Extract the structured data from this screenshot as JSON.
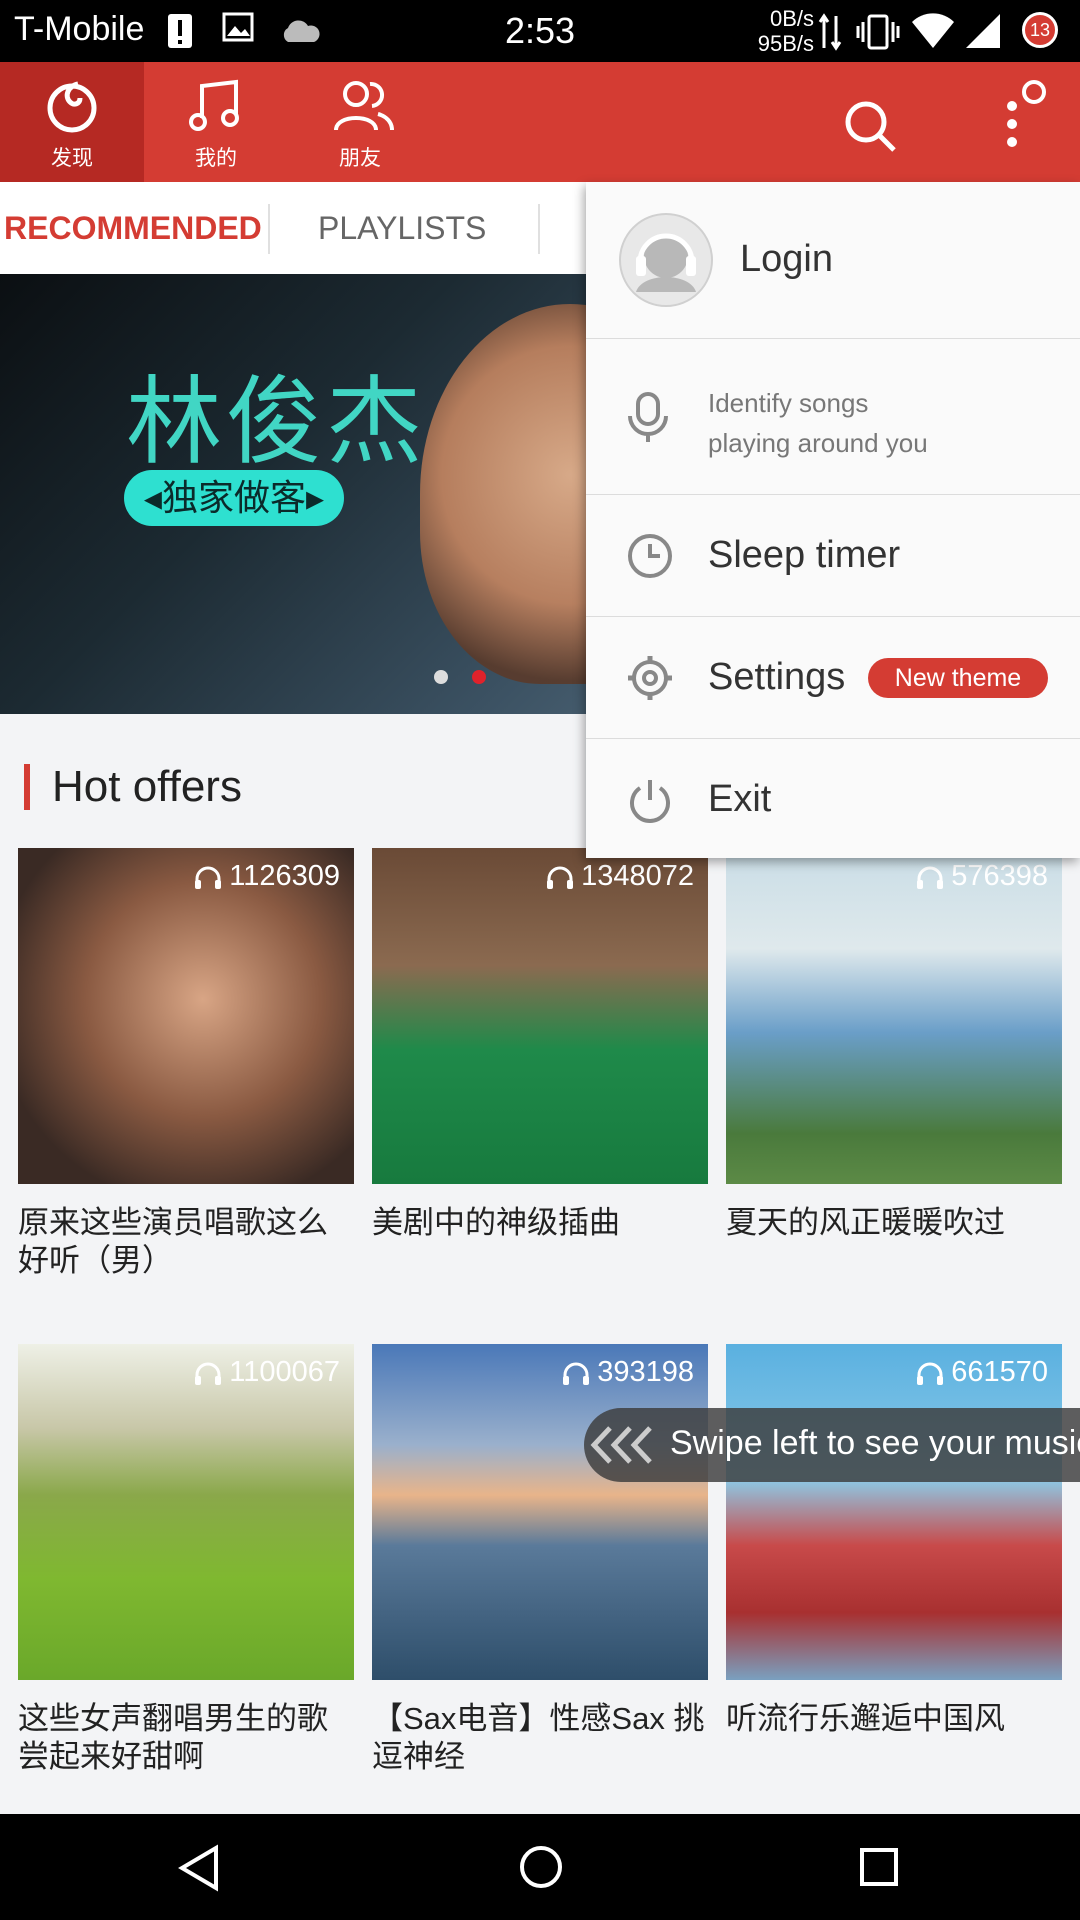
{
  "status_bar": {
    "carrier": "T-Mobile",
    "time": "2:53",
    "net_up": "0B/s",
    "net_down": "95B/s",
    "notification_count": "13"
  },
  "top_nav": {
    "tabs": [
      {
        "label": "发现",
        "icon": "netease-logo-icon",
        "active": true
      },
      {
        "label": "我的",
        "icon": "music-note-icon",
        "active": false
      },
      {
        "label": "朋友",
        "icon": "friends-icon",
        "active": false
      }
    ],
    "accent": "#d43c33"
  },
  "sub_tabs": {
    "recommended": "RECOMMENDED",
    "playlists": "PLAYLISTS"
  },
  "banner": {
    "artist_name": "林俊杰",
    "tag": "◂独家做客▸"
  },
  "section": {
    "title": "Hot offers"
  },
  "playlists": [
    {
      "count": "1126309",
      "title": "原来这些演员唱歌这么好听（男）"
    },
    {
      "count": "1348072",
      "title": "美剧中的神级插曲"
    },
    {
      "count": "576398",
      "title": "夏天的风正暖暖吹过"
    },
    {
      "count": "1100067",
      "title": "这些女声翻唱男生的歌尝起来好甜啊"
    },
    {
      "count": "393198",
      "title": "【Sax电音】性感Sax 挑逗神经"
    },
    {
      "count": "661570",
      "title": "听流行乐邂逅中国风"
    }
  ],
  "menu": {
    "login": "Login",
    "identify_line1": "Identify songs",
    "identify_line2": "playing around you",
    "sleep_timer": "Sleep timer",
    "settings": "Settings",
    "settings_badge": "New theme",
    "exit": "Exit"
  },
  "toast": {
    "text": "Swipe left to see your music"
  }
}
